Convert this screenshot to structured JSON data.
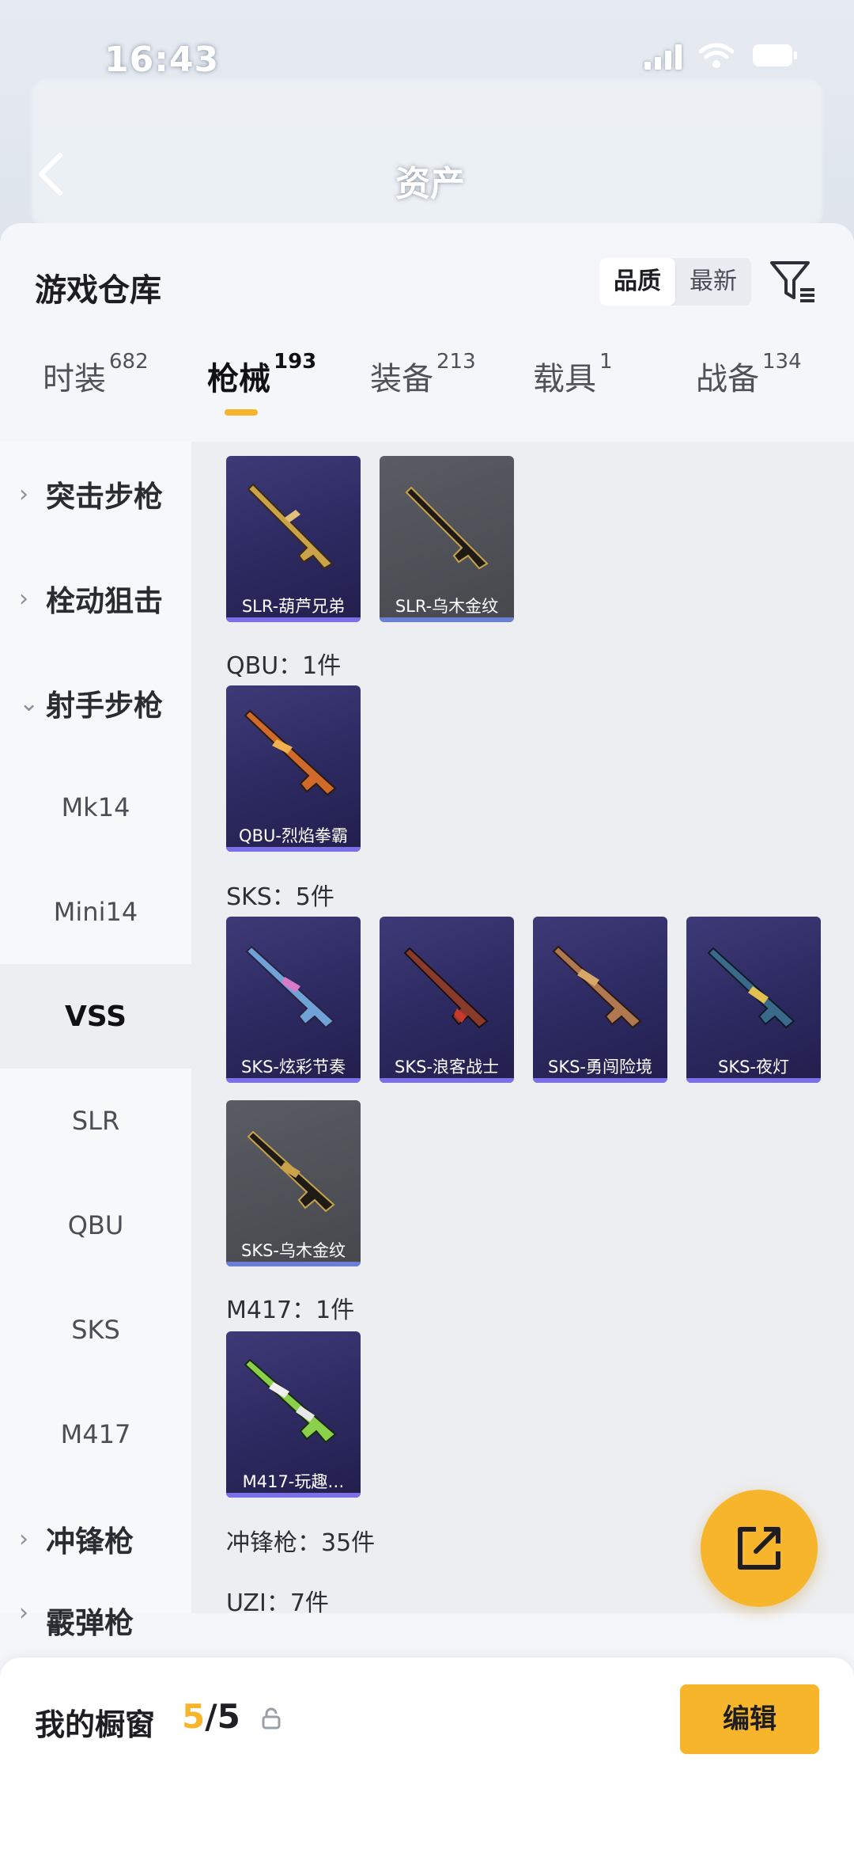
{
  "status_bar": {
    "time": "16:43"
  },
  "header": {
    "title": "资产"
  },
  "panel": {
    "title": "游戏仓库",
    "sort": {
      "options": [
        "品质",
        "最新"
      ],
      "selected": "品质"
    }
  },
  "tabs": [
    {
      "label": "时装",
      "count": "682"
    },
    {
      "label": "枪械",
      "count": "193",
      "active": true
    },
    {
      "label": "装备",
      "count": "213"
    },
    {
      "label": "载具",
      "count": "1"
    },
    {
      "label": "战备",
      "count": "134"
    }
  ],
  "sidebar": {
    "items": [
      {
        "label": "突击步枪",
        "type": "category",
        "expanded": false
      },
      {
        "label": "栓动狙击",
        "type": "category",
        "expanded": false
      },
      {
        "label": "射手步枪",
        "type": "category",
        "expanded": true
      },
      {
        "label": "Mk14",
        "type": "sub"
      },
      {
        "label": "Mini14",
        "type": "sub"
      },
      {
        "label": "VSS",
        "type": "sub",
        "active": true
      },
      {
        "label": "SLR",
        "type": "sub"
      },
      {
        "label": "QBU",
        "type": "sub"
      },
      {
        "label": "SKS",
        "type": "sub"
      },
      {
        "label": "M417",
        "type": "sub"
      },
      {
        "label": "冲锋枪",
        "type": "category",
        "expanded": false
      },
      {
        "label": "霰弹枪",
        "type": "category",
        "expanded": false
      }
    ]
  },
  "content": {
    "slr_cards": [
      {
        "name": "SLR-葫芦兄弟",
        "rarity": "purple"
      },
      {
        "name": "SLR-乌木金纹",
        "rarity": "gray"
      }
    ],
    "qbu_section": "QBU：1件",
    "qbu_cards": [
      {
        "name": "QBU-烈焰拳霸",
        "rarity": "purple"
      }
    ],
    "sks_section": "SKS：5件",
    "sks_cards_row1": [
      {
        "name": "SKS-炫彩节奏",
        "rarity": "purple"
      },
      {
        "name": "SKS-浪客战士",
        "rarity": "purple"
      },
      {
        "name": "SKS-勇闯险境",
        "rarity": "purple"
      },
      {
        "name": "SKS-夜灯",
        "rarity": "purple"
      }
    ],
    "sks_cards_row2": [
      {
        "name": "SKS-乌木金纹",
        "rarity": "gray"
      }
    ],
    "m417_section": "M417：1件",
    "m417_cards": [
      {
        "name": "M417-玩趣…",
        "rarity": "purple"
      }
    ],
    "smg_section": "冲锋枪：35件",
    "uzi_section": "UZI：7件"
  },
  "bottom_bar": {
    "title": "我的橱窗",
    "count_current": "5",
    "count_sep_total": "/5",
    "edit_label": "编辑"
  },
  "colors": {
    "accent": "#f7b52c",
    "card_purple": "#2c2960",
    "card_gray": "#4e5056"
  },
  "icons": [
    "signal-icon",
    "wifi-icon",
    "battery-icon",
    "back-arrow-icon",
    "filter-icon",
    "chevron-right-icon",
    "chevron-down-icon",
    "share-icon",
    "lock-icon"
  ]
}
